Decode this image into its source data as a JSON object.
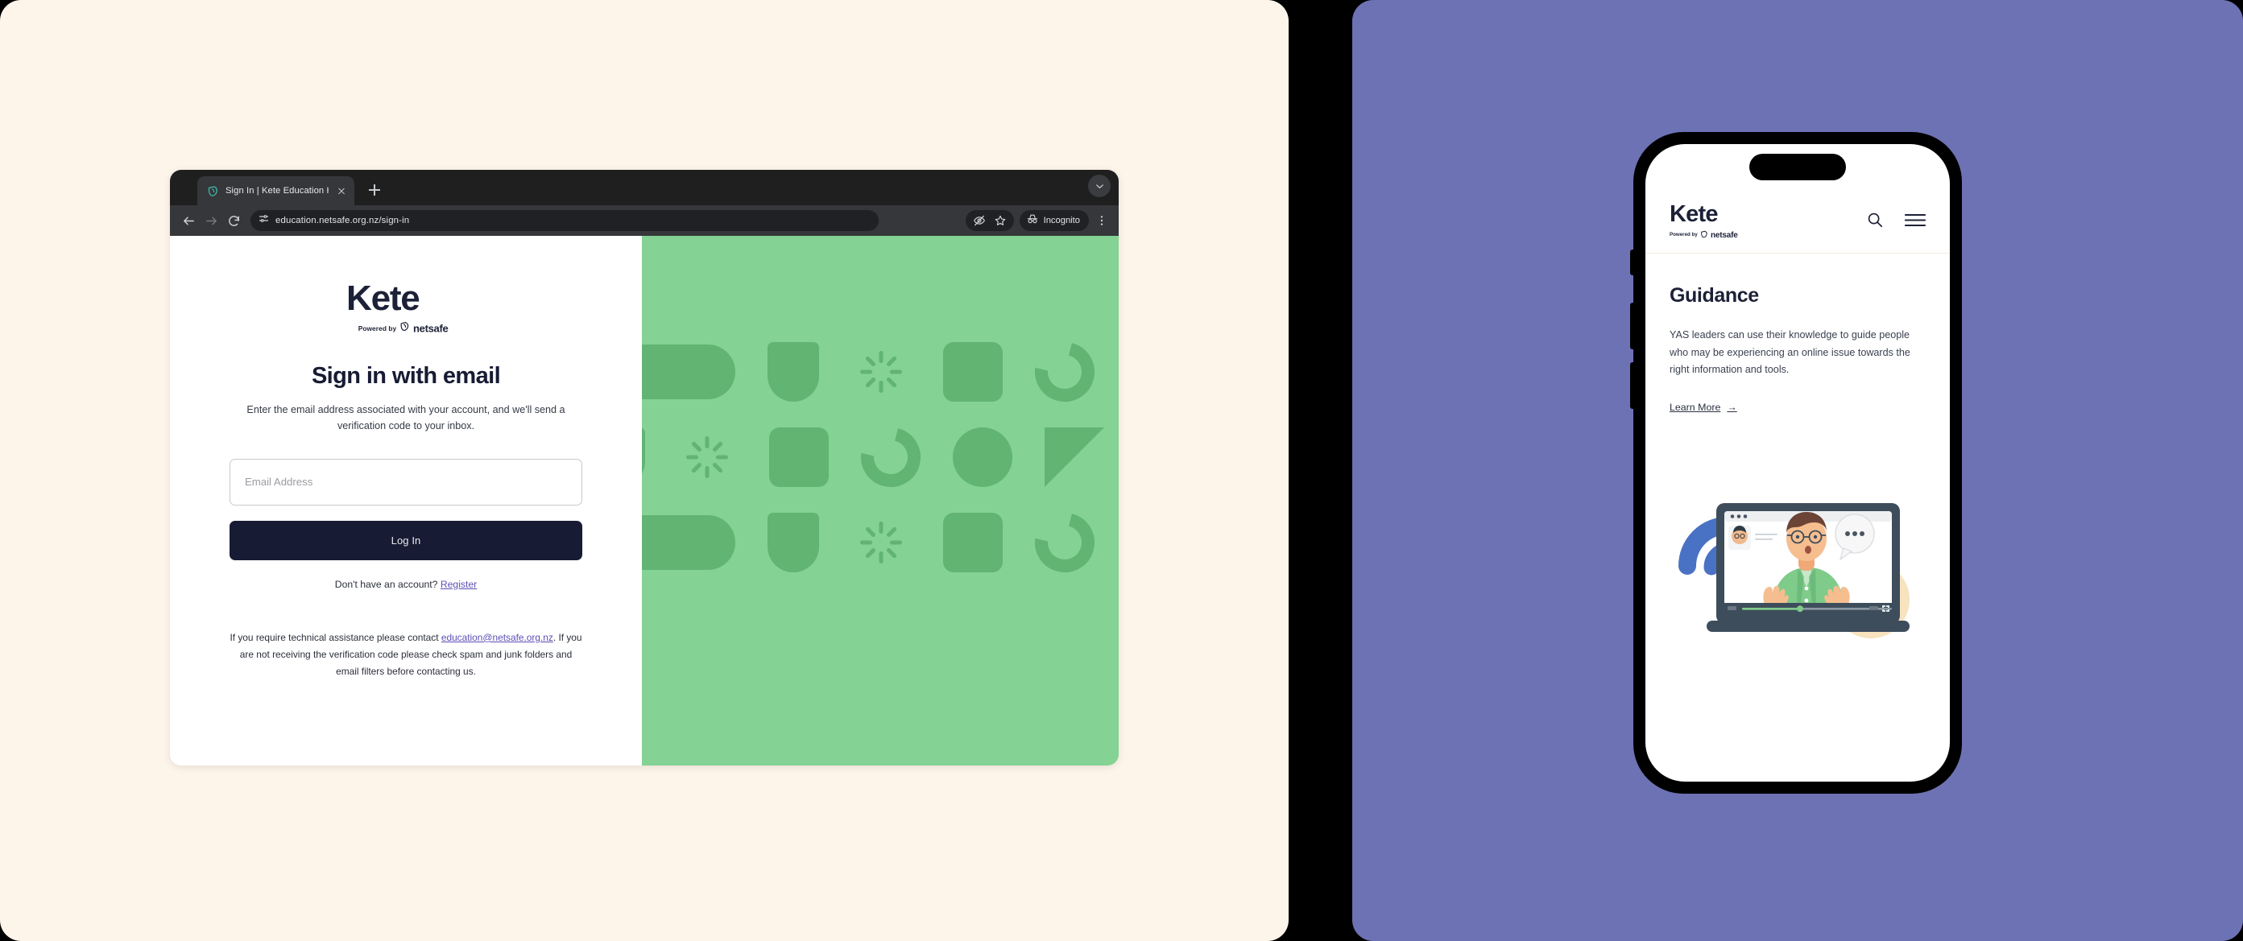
{
  "colors": {
    "cream_background": "#FEF5EA",
    "purple_background": "#6D72B5",
    "green_panel": "#84D294",
    "green_shape": "#61B472",
    "navy": "#171B33",
    "link_purple": "#5B4FB5",
    "browser_tabstrip": "#1F1F1F",
    "browser_toolbar": "#35373A",
    "omnibox": "#202124"
  },
  "browser": {
    "tab": {
      "title": "Sign In | Kete Education Hub",
      "favicon_name": "netsafe-shield-favicon",
      "close_label": "Close tab"
    },
    "new_tab_label": "New Tab",
    "nav": {
      "back_label": "Back",
      "forward_label": "Forward",
      "reload_label": "Reload"
    },
    "omnibox": {
      "url": "education.netsafe.org.nz/sign-in",
      "site_settings_icon": "tune-icon"
    },
    "toolbar_right": {
      "eye_slash_label": "Hide",
      "bookmark_label": "Bookmark",
      "incognito_label": "Incognito",
      "menu_label": "Customize and control"
    }
  },
  "signin": {
    "logo": {
      "wordmark": "Kete",
      "powered_by": "Powered by",
      "netsafe": "netsafe"
    },
    "title": "Sign in with email",
    "subtitle": "Enter the email address associated with your account, and we'll send a verification code to your inbox.",
    "email": {
      "placeholder": "Email Address",
      "value": ""
    },
    "login_button": "Log In",
    "register_prompt": "Don't have an account?",
    "register_link": "Register",
    "help": {
      "before": "If you require technical assistance please contact ",
      "email": "education@netsafe.org.nz",
      "after": ". If you are not receiving the verification code please check spam and junk folders and email filters before contacting us."
    }
  },
  "pattern": {
    "rows": [
      [
        "pill",
        "shield",
        "burst",
        "square",
        "arc"
      ],
      [
        "shield",
        "burst",
        "square",
        "arc",
        "circle",
        "triangle"
      ],
      [
        "pill",
        "shield",
        "burst",
        "square",
        "arc"
      ]
    ]
  },
  "phone": {
    "header": {
      "wordmark": "Kete",
      "powered_by": "Powered by",
      "netsafe": "netsafe",
      "search_label": "Search",
      "menu_label": "Menu"
    },
    "title": "Guidance",
    "body": "YAS leaders can use their knowledge to guide people who may be experiencing an online issue towards the right information and tools.",
    "learn_more": "Learn More",
    "learn_more_arrow": "→",
    "illustration_name": "laptop-video-call-illustration"
  }
}
